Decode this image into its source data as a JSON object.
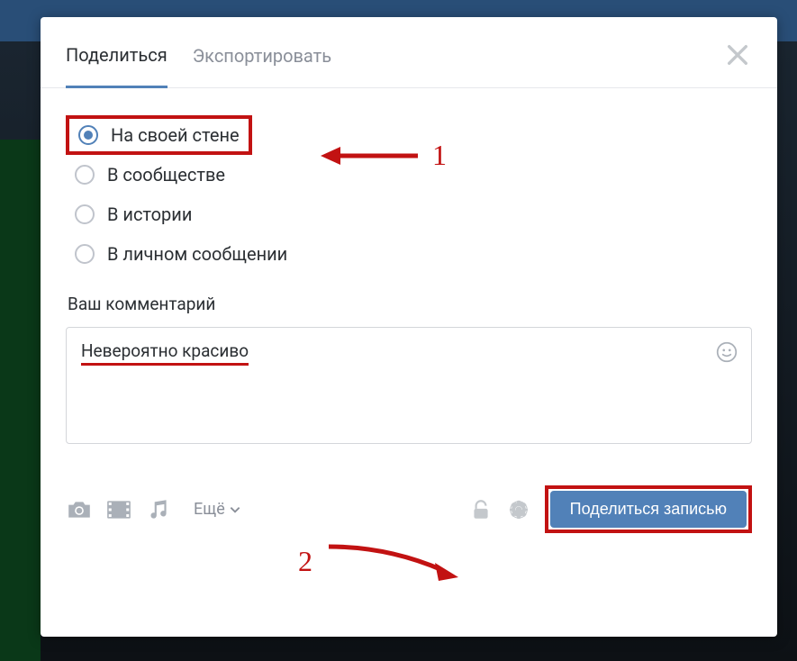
{
  "tabs": {
    "share": "Поделиться",
    "export": "Экспортировать"
  },
  "radios": {
    "own_wall": "На своей стене",
    "community": "В сообществе",
    "story": "В истории",
    "private_message": "В личном сообщении"
  },
  "comment": {
    "label": "Ваш комментарий",
    "text": "Невероятно красиво"
  },
  "footer": {
    "more": "Ещё",
    "share_button": "Поделиться записью"
  },
  "annotations": {
    "one": "1",
    "two": "2"
  }
}
